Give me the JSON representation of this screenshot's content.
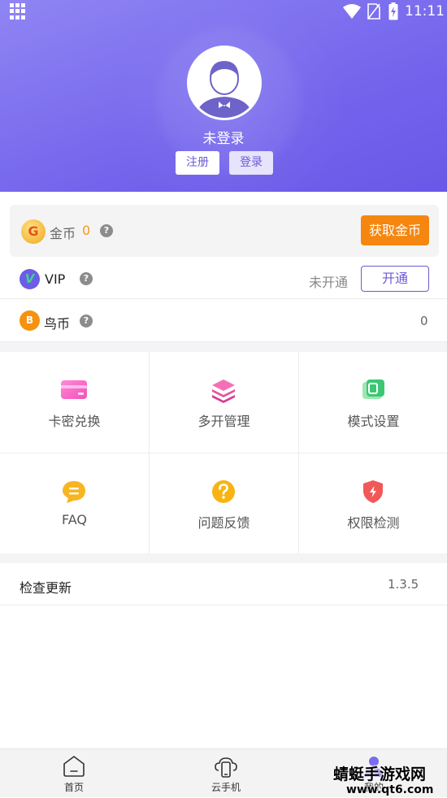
{
  "status_bar": {
    "time": "11:11"
  },
  "profile": {
    "username": "未登录",
    "register_label": "注册",
    "login_label": "登录"
  },
  "coins": {
    "badge": "G",
    "label": "金币",
    "value": "0",
    "help": "?",
    "get_button": "获取金币"
  },
  "vip": {
    "badge": "V",
    "label": "VIP",
    "help": "?",
    "status": "未开通",
    "activate_button": "开通"
  },
  "bird_coins": {
    "badge": "B",
    "label": "鸟币",
    "help": "?",
    "value": "0"
  },
  "features": [
    {
      "label": "卡密兑换",
      "icon": "card-icon"
    },
    {
      "label": "多开管理",
      "icon": "layers-icon"
    },
    {
      "label": "模式设置",
      "icon": "mode-icon"
    },
    {
      "label": "FAQ",
      "icon": "chat-icon"
    },
    {
      "label": "问题反馈",
      "icon": "question-icon"
    },
    {
      "label": "权限检测",
      "icon": "shield-icon"
    }
  ],
  "update": {
    "label": "检查更新",
    "version": "1.3.5"
  },
  "bottom_nav": [
    {
      "label": "首页",
      "icon": "home-icon"
    },
    {
      "label": "云手机",
      "icon": "cloud-phone-icon"
    },
    {
      "label": "我的",
      "icon": "profile-icon"
    }
  ],
  "watermark": {
    "text": "蜻蜓手游戏网",
    "sub": "www.qt6.com"
  },
  "colors": {
    "header_start": "#8f85f3",
    "header_end": "#6a57e8",
    "accent": "#6b5bd6",
    "orange": "#f5860f"
  }
}
